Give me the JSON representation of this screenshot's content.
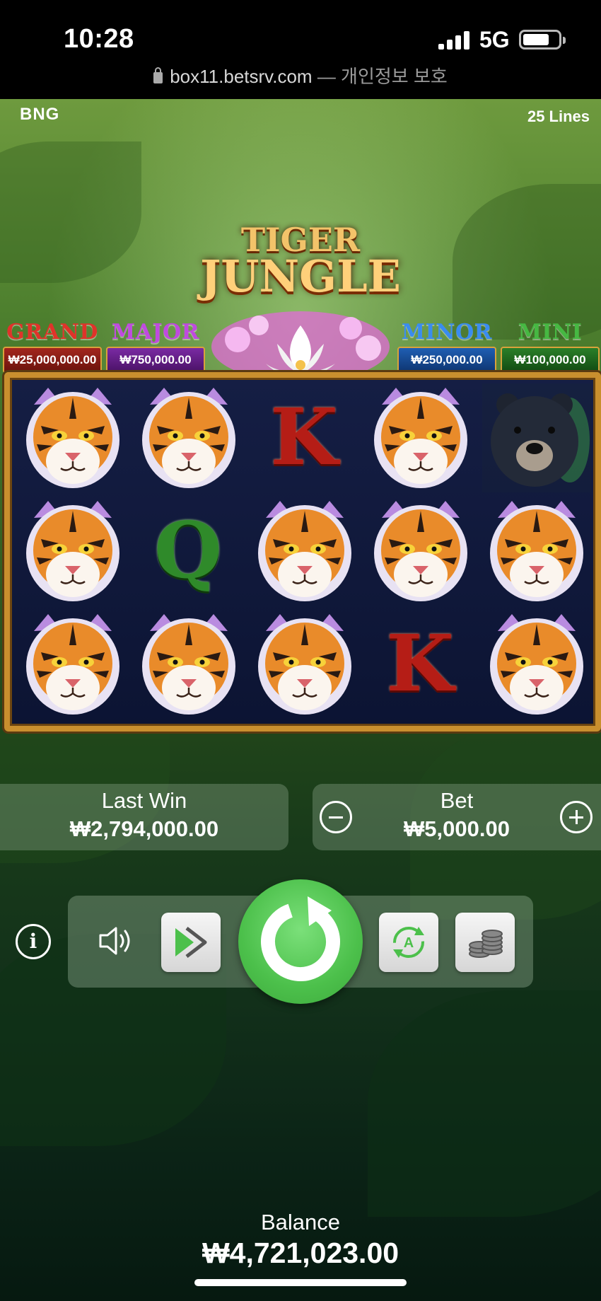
{
  "status_bar": {
    "time": "10:28",
    "network": "5G",
    "url": "box11.betsrv.com",
    "url_suffix": "— 개인정보 보호"
  },
  "game": {
    "provider": "BNG",
    "lines_label": "25 Lines",
    "title_line1": "TIGER",
    "title_line2": "JUNGLE",
    "jackpots": [
      {
        "name": "GRAND",
        "amount": "₩25,000,000.00",
        "color": "#e0332a"
      },
      {
        "name": "MAJOR",
        "amount": "₩750,000.00",
        "color": "#b23bd6"
      },
      {
        "name": "MINOR",
        "amount": "₩250,000.00",
        "color": "#2f7fe0"
      },
      {
        "name": "MINI",
        "amount": "₩100,000.00",
        "color": "#3da83a"
      }
    ],
    "reels": [
      [
        "tiger",
        "tiger",
        "tiger"
      ],
      [
        "tiger",
        "Q",
        "tiger"
      ],
      [
        "K",
        "tiger",
        "tiger"
      ],
      [
        "tiger",
        "tiger",
        "K"
      ],
      [
        "bear",
        "tiger",
        "tiger"
      ]
    ],
    "last_win": {
      "label": "Last Win",
      "value": "₩2,794,000.00"
    },
    "bet": {
      "label": "Bet",
      "value": "₩5,000.00"
    },
    "balance": {
      "label": "Balance",
      "value": "₩4,721,023.00"
    }
  },
  "controls": {
    "icons": [
      "info-icon",
      "sound-icon",
      "turbo-icon",
      "spin-icon",
      "autoplay-icon",
      "coins-icon"
    ],
    "accent_color": "#4cc04b"
  }
}
